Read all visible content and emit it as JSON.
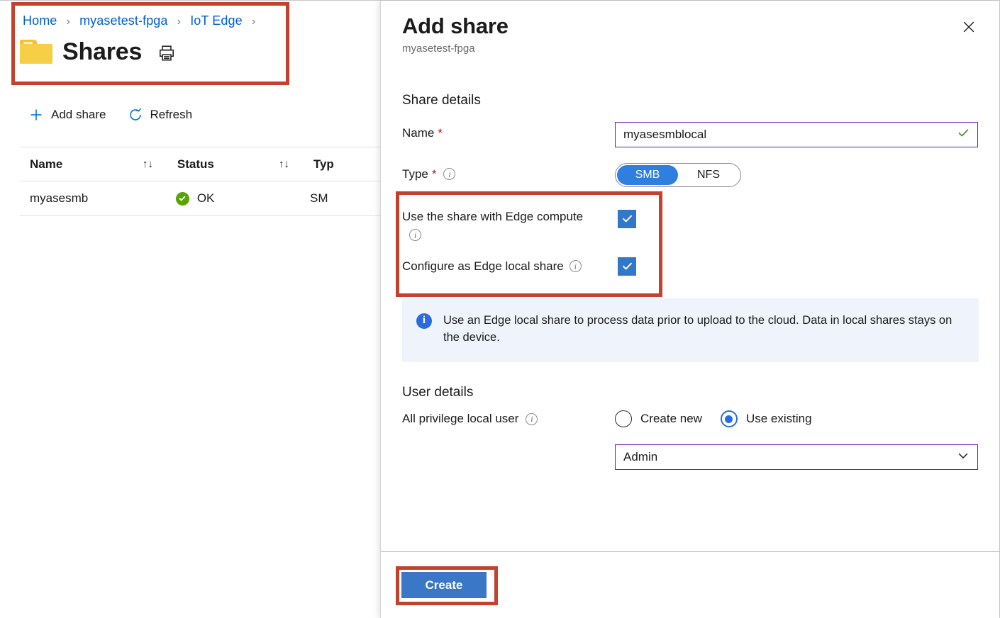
{
  "breadcrumb": {
    "items": [
      {
        "label": "Home"
      },
      {
        "label": "myasetest-fpga"
      },
      {
        "label": "IoT Edge"
      }
    ],
    "separator": "›"
  },
  "page": {
    "title": "Shares",
    "folder_icon": "folder-icon",
    "print_icon": "print-icon"
  },
  "command_bar": {
    "add_share": {
      "label": "Add share",
      "icon": "plus-icon"
    },
    "refresh": {
      "label": "Refresh",
      "icon": "refresh-icon"
    }
  },
  "table": {
    "columns": [
      {
        "label": "Name",
        "sort_icon": "sort-updown-icon"
      },
      {
        "label": "Status",
        "sort_icon": "sort-updown-icon"
      },
      {
        "label": "Typ"
      }
    ],
    "rows": [
      {
        "name": "myasesmb",
        "status": "OK",
        "status_icon": "check-circle-icon",
        "type": "SM"
      }
    ]
  },
  "blade": {
    "title": "Add share",
    "subtitle": "myasetest-fpga",
    "close_icon": "close-icon",
    "share_details": {
      "heading": "Share details",
      "name": {
        "label": "Name",
        "required_marker": "*",
        "value": "myasesmblocal",
        "placeholder": "",
        "validation_icon": "checkmark-icon"
      },
      "type": {
        "label": "Type",
        "required_marker": "*",
        "info_icon": "info-icon",
        "options": [
          "SMB",
          "NFS"
        ],
        "selected": "SMB"
      },
      "edge_compute": {
        "label": "Use the share with Edge compute",
        "info_icon": "info-icon",
        "checked": true
      },
      "edge_local": {
        "label": "Configure as Edge local share",
        "info_icon": "info-icon",
        "checked": true
      }
    },
    "info_banner": {
      "icon": "info-filled-icon",
      "text": "Use an Edge local share to process data prior to upload to the cloud. Data in local shares stays on the device."
    },
    "user_details": {
      "heading": "User details",
      "local_user": {
        "label": "All privilege local user",
        "info_icon": "info-icon",
        "options": [
          {
            "label": "Create new",
            "selected": false
          },
          {
            "label": "Use existing",
            "selected": true
          }
        ]
      },
      "user_select": {
        "value": "Admin",
        "chevron_icon": "chevron-down-icon"
      }
    },
    "footer": {
      "create_label": "Create"
    }
  },
  "colors": {
    "annotation_red": "#c4412e",
    "accent_blue": "#2f7fe0",
    "link_blue": "#015cda",
    "focus_purple": "#7719aa",
    "success_green": "#57a300",
    "banner_bg": "#eff4fc",
    "folder_yellow": "#f7cf46"
  }
}
